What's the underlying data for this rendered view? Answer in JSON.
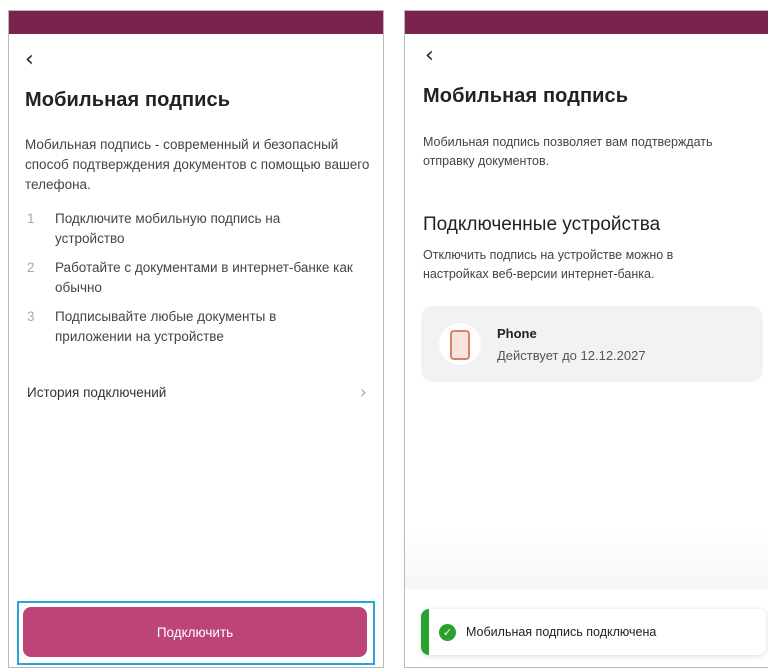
{
  "left_screen": {
    "back_label": "‹",
    "title": "Мобильная подпись",
    "description": "Мобильная подпись - современный и безопасный способ подтверждения документов с помощью вашего телефона.",
    "steps": [
      {
        "num": "1",
        "text": "Подключите мобильную подпись на устройство"
      },
      {
        "num": "2",
        "text": "Работайте с документами в интернет-банке как обычно"
      },
      {
        "num": "3",
        "text": "Подписывайте любые документы в приложении на устройстве"
      }
    ],
    "history_label": "История подключений",
    "history_chevron": "›",
    "connect_button": "Подключить"
  },
  "right_screen": {
    "back_label": "‹",
    "title": "Мобильная подпись",
    "description": "Мобильная подпись позволяет вам подтверждать отправку документов.",
    "devices_title": "Подключенные устройства",
    "devices_hint": "Отключить подпись на устройстве можно в настройках веб-версии интернет-банка.",
    "device": {
      "name": "Phone",
      "valid_until": "Действует до 12.12.2027",
      "icon": "phone-icon"
    },
    "toast": {
      "check": "✓",
      "text": "Мобильная подпись подключена"
    }
  },
  "colors": {
    "status_bar": "#7b2350",
    "primary_button": "#bc4477",
    "highlight_border": "#29a4d8",
    "success": "#2aa02e"
  }
}
